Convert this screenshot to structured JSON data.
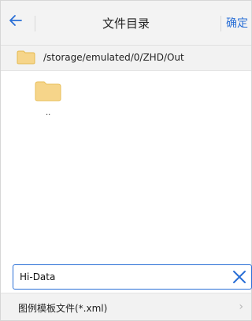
{
  "header": {
    "back_icon": "back-arrow-icon",
    "title": "文件目录",
    "confirm_label": "确定"
  },
  "path": {
    "icon": "folder-icon",
    "text": "/storage/emulated/0/ZHD/Out"
  },
  "items": [
    {
      "icon": "folder-icon",
      "label": ".."
    }
  ],
  "filename": {
    "value": "Hi-Data",
    "clear_icon": "close-x-icon"
  },
  "filter": {
    "label": "图例模板文件(*.xml)",
    "chevron_icon": "chevron-right-icon"
  },
  "colors": {
    "accent": "#2a6fd6",
    "folder": "#f6d58a",
    "bar": "#f2f2f2"
  }
}
